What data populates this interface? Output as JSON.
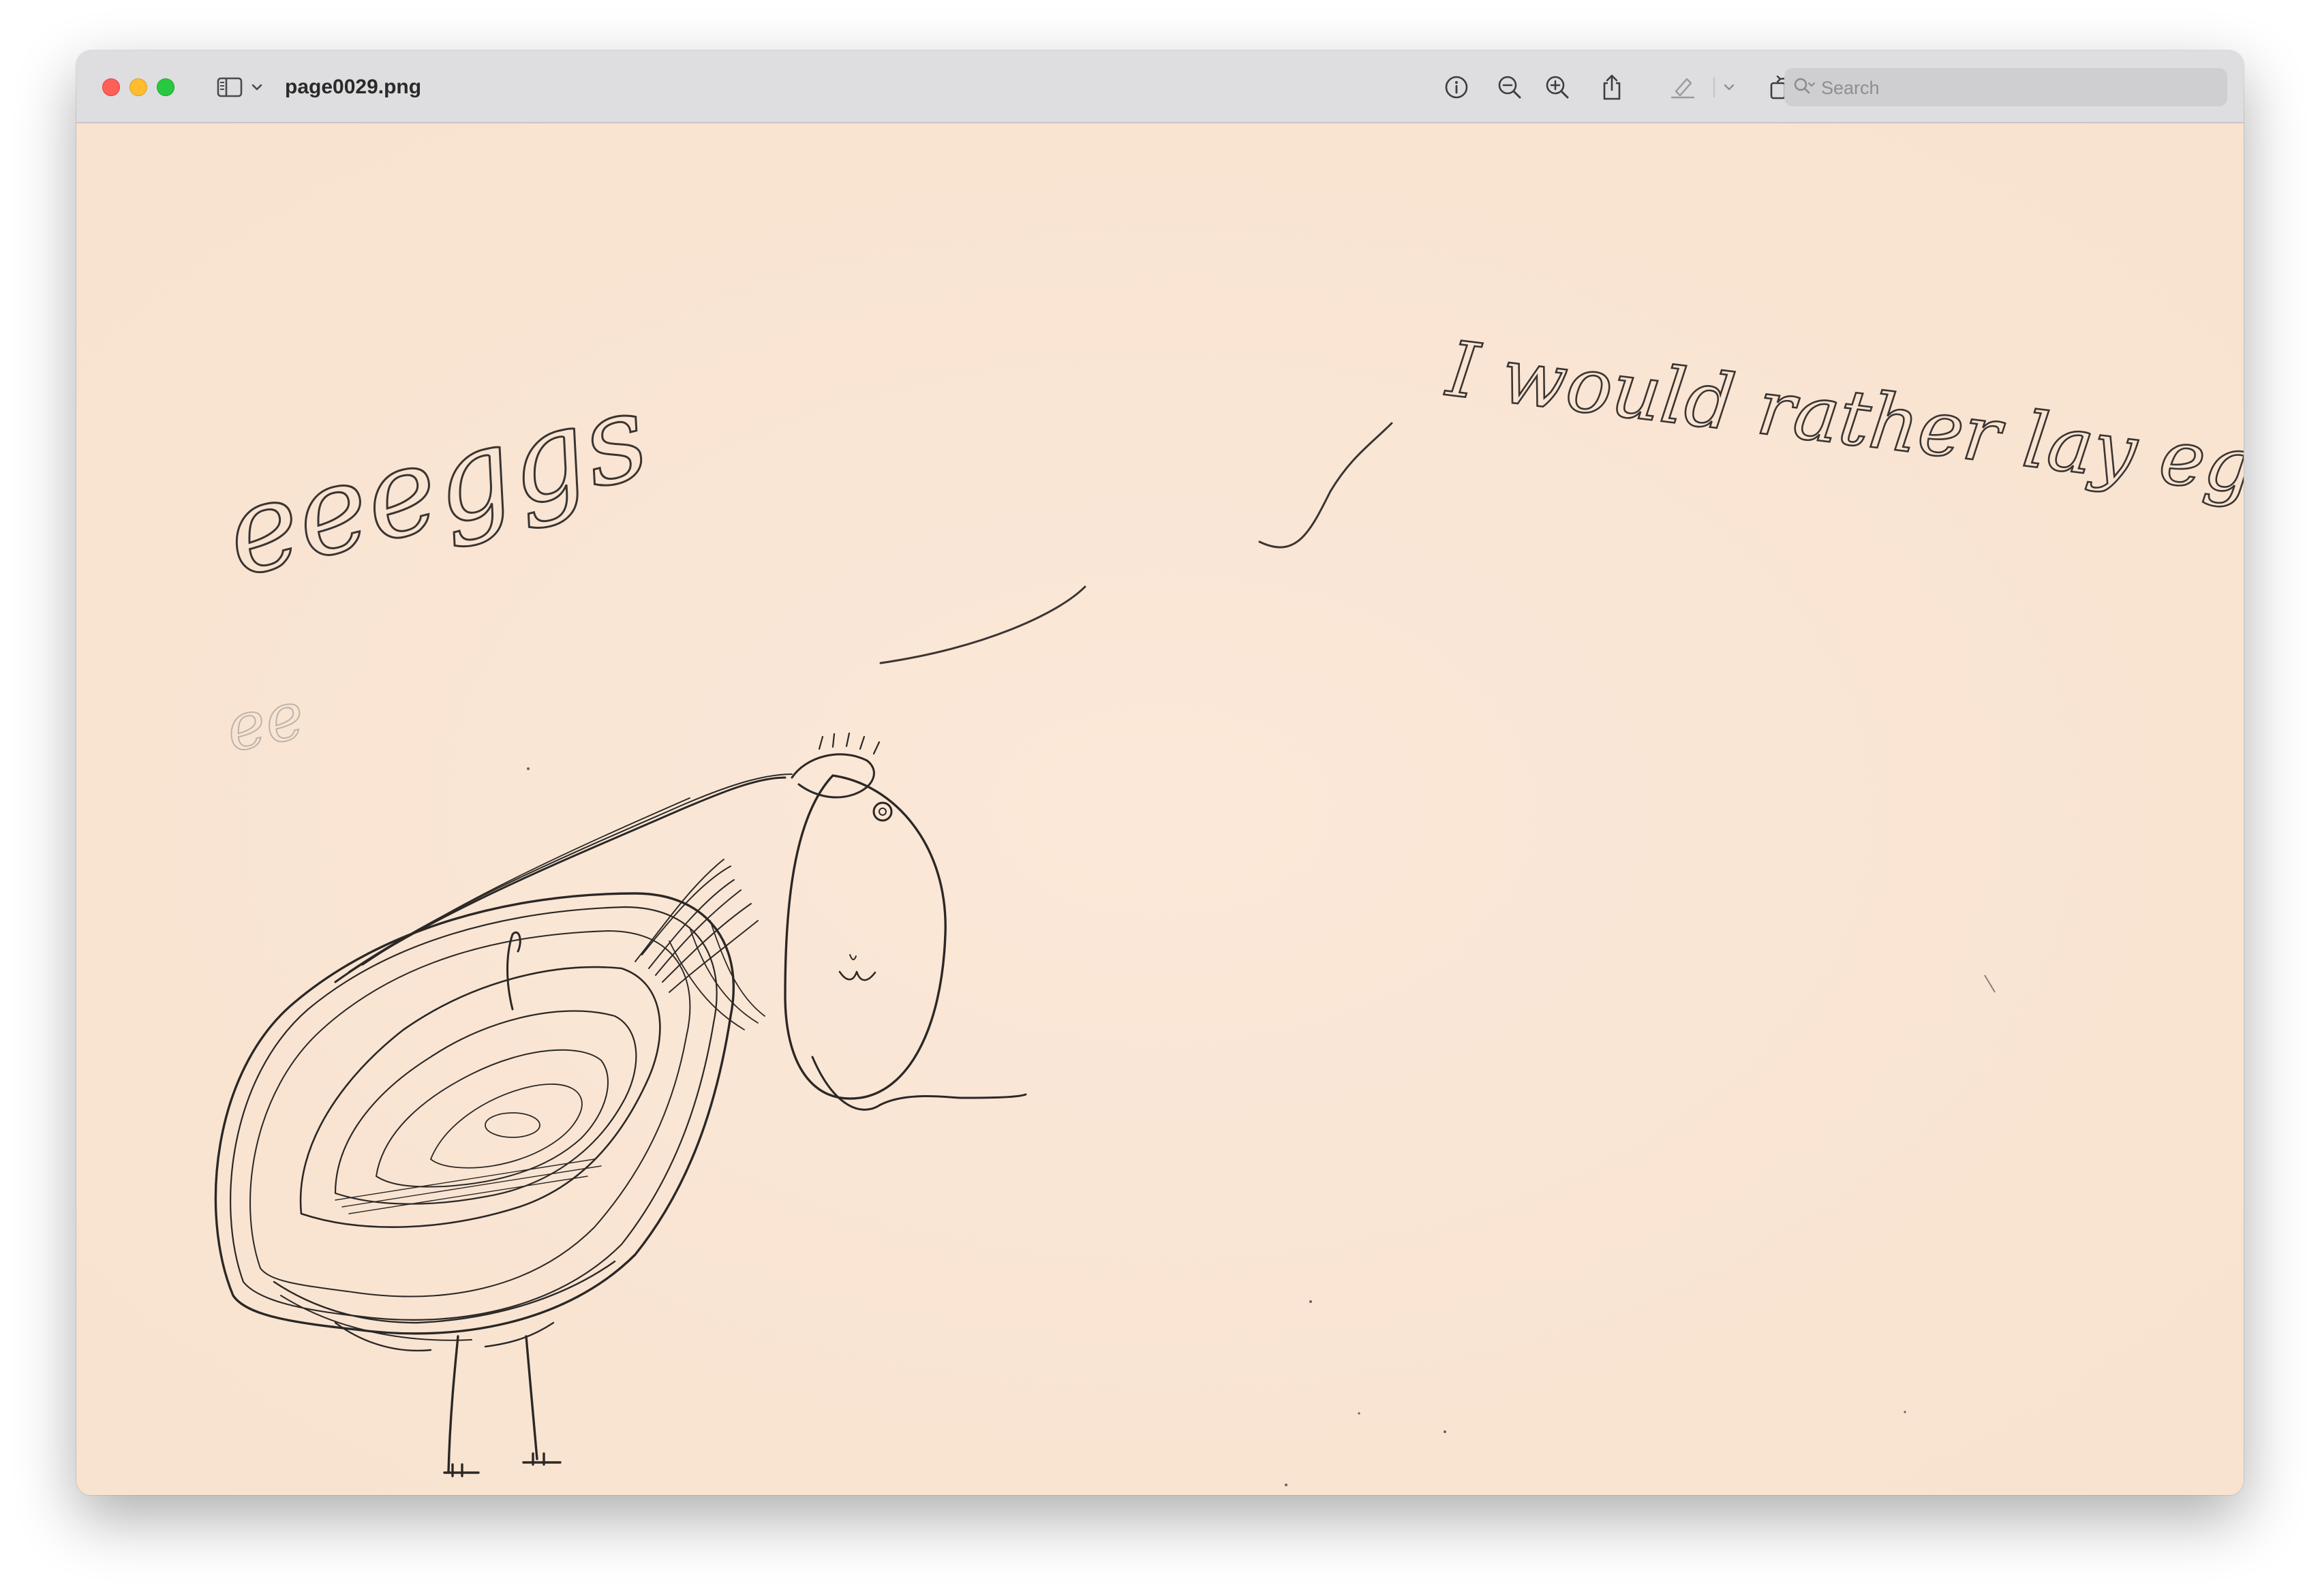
{
  "window": {
    "file_name": "page0029.png"
  },
  "toolbar": {
    "sidebar_toggle_icon": "sidebar-icon",
    "sidebar_menu_icon": "chevron-down-icon",
    "info_icon": "info-icon",
    "zoom_out_icon": "zoom-out-icon",
    "zoom_in_icon": "zoom-in-icon",
    "share_icon": "share-icon",
    "markup_icon": "highlighter-icon",
    "markup_menu_icon": "chevron-down-icon",
    "rotate_icon": "rotate-icon",
    "annotate_icon": "markup-icon",
    "search_placeholder": "Search"
  },
  "colors": {
    "paper": "#fbe7d7",
    "ink": "#2b2826",
    "titlebar": "#dedddf"
  },
  "drawing": {
    "handwriting_left": "eeeggs",
    "handwriting_left_faint": "ee",
    "handwriting_right": "I would rather lay eggs"
  }
}
